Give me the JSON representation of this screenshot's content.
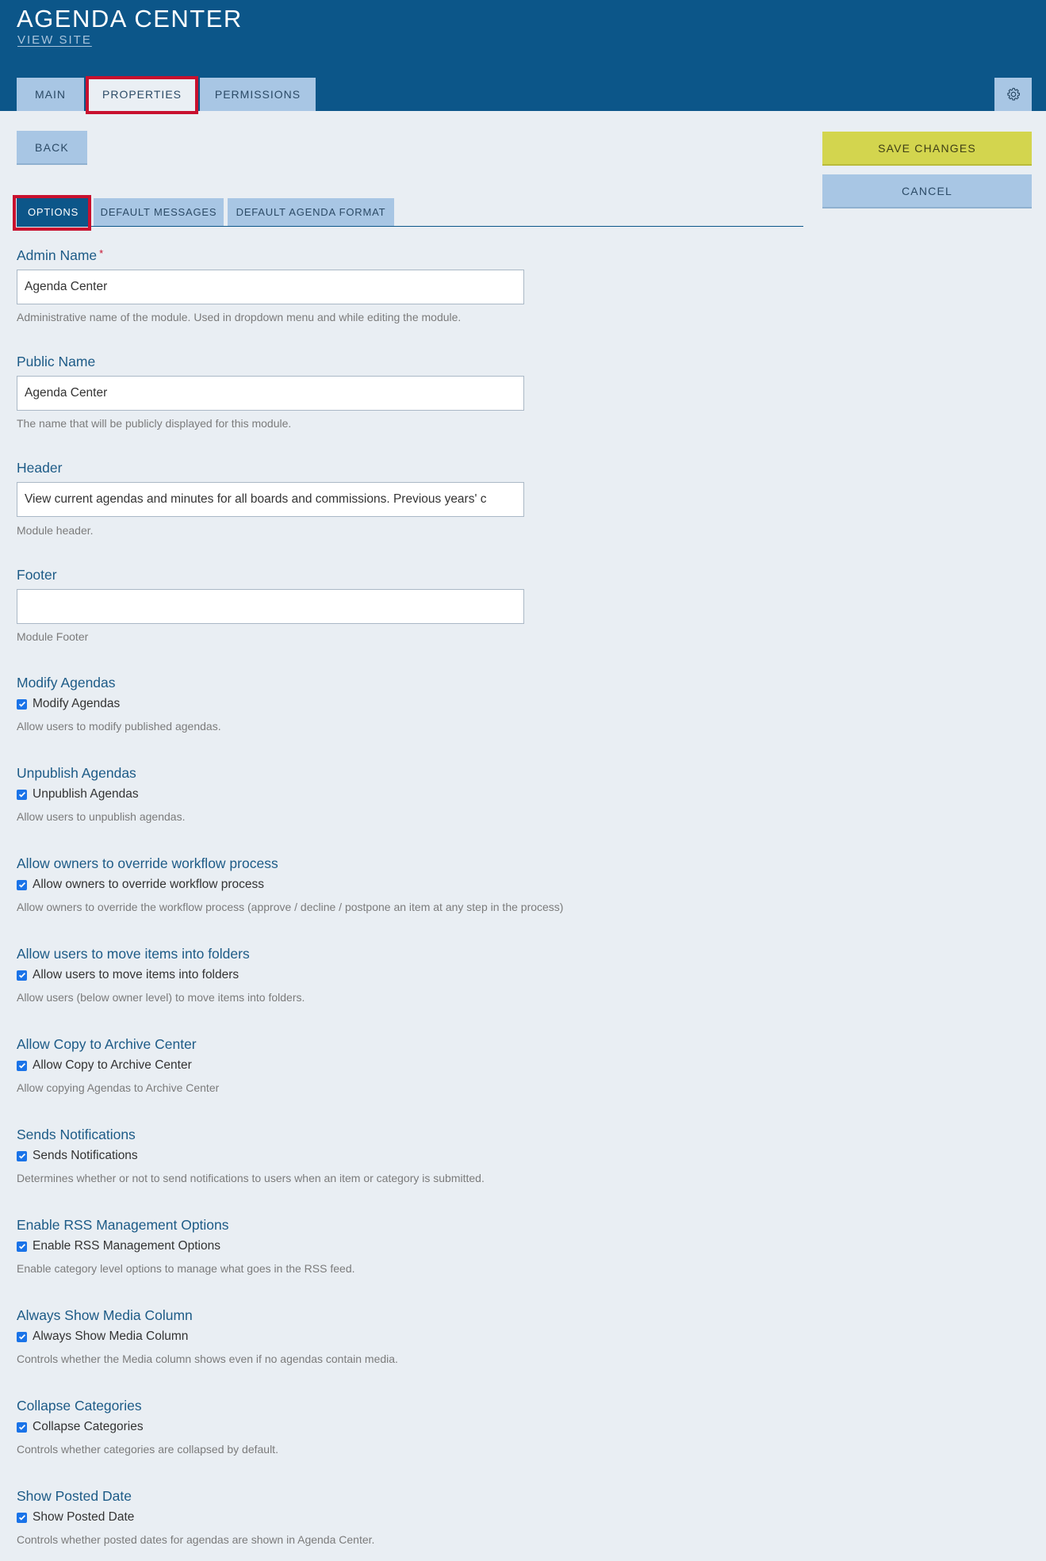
{
  "header": {
    "title": "AGENDA CENTER",
    "view_site": "VIEW SITE",
    "tabs": [
      "MAIN",
      "PROPERTIES",
      "PERMISSIONS"
    ]
  },
  "actions": {
    "back": "BACK",
    "save": "SAVE CHANGES",
    "cancel": "CANCEL"
  },
  "subtabs": [
    "OPTIONS",
    "DEFAULT MESSAGES",
    "DEFAULT AGENDA FORMAT"
  ],
  "fields": {
    "admin_name": {
      "label": "Admin Name",
      "required_mark": "*",
      "value": "Agenda Center",
      "help": "Administrative name of the module. Used in dropdown menu and while editing the module."
    },
    "public_name": {
      "label": "Public Name",
      "value": "Agenda Center",
      "help": "The name that will be publicly displayed for this module."
    },
    "header": {
      "label": "Header",
      "value": "View current agendas and minutes for all boards and commissions. Previous years' c",
      "help": "Module header."
    },
    "footer": {
      "label": "Footer",
      "value": "",
      "help": "Module Footer"
    }
  },
  "options": [
    {
      "label": "Modify Agendas",
      "checkbox": "Modify Agendas",
      "checked": true,
      "help": "Allow users to modify published agendas."
    },
    {
      "label": "Unpublish Agendas",
      "checkbox": "Unpublish Agendas",
      "checked": true,
      "help": "Allow users to unpublish agendas."
    },
    {
      "label": "Allow owners to override workflow process",
      "checkbox": "Allow owners to override workflow process",
      "checked": true,
      "help": "Allow owners to override the workflow process (approve / decline / postpone an item at any step in the process)"
    },
    {
      "label": "Allow users to move items into folders",
      "checkbox": "Allow users to move items into folders",
      "checked": true,
      "help": "Allow users (below owner level) to move items into folders."
    },
    {
      "label": "Allow Copy to Archive Center",
      "checkbox": "Allow Copy to Archive Center",
      "checked": true,
      "help": "Allow copying Agendas to Archive Center"
    },
    {
      "label": "Sends Notifications",
      "checkbox": "Sends Notifications",
      "checked": true,
      "help": "Determines whether or not to send notifications to users when an item or category is submitted."
    },
    {
      "label": "Enable RSS Management Options",
      "checkbox": "Enable RSS Management Options",
      "checked": true,
      "help": "Enable category level options to manage what goes in the RSS feed."
    },
    {
      "label": "Always Show Media Column",
      "checkbox": "Always Show Media Column",
      "checked": true,
      "help": "Controls whether the Media column shows even if no agendas contain media."
    },
    {
      "label": "Collapse Categories",
      "checkbox": "Collapse Categories",
      "checked": true,
      "help": "Controls whether categories are collapsed by default."
    },
    {
      "label": "Show Posted Date",
      "checkbox": "Show Posted Date",
      "checked": true,
      "help": "Controls whether posted dates for agendas are shown in Agenda Center."
    }
  ],
  "icons": {
    "settings": "gear-icon",
    "checkbox": "check-icon"
  },
  "colors": {
    "header_bg": "#0c5689",
    "tab_bg": "#a8c6e4",
    "save_bg": "#d3d54e",
    "highlight": "#c8102e",
    "label": "#1d5b87"
  }
}
